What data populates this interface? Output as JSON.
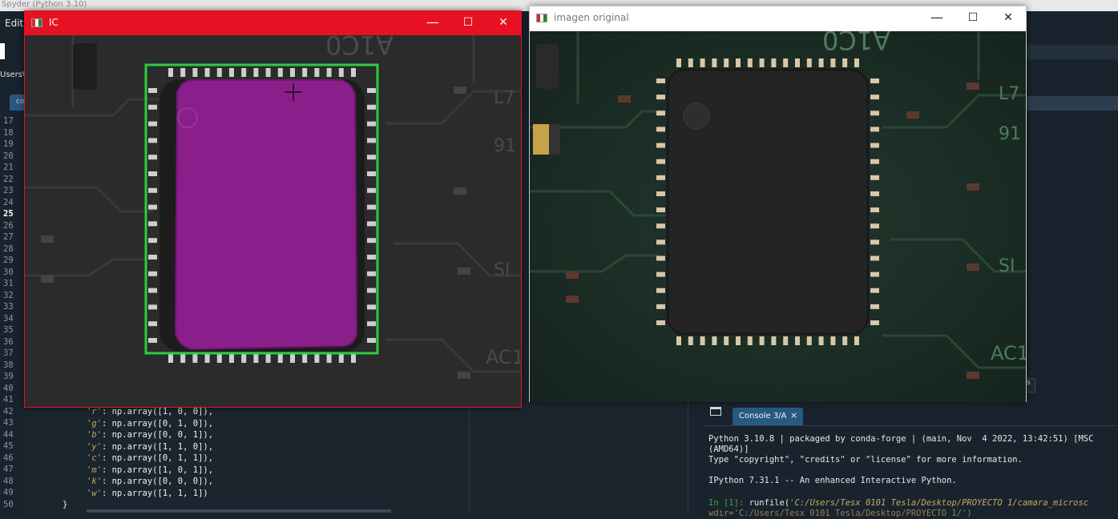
{
  "spyder": {
    "title": "Spyder (Python 3.10)",
    "menu_edit": "Edit",
    "path_fragment": "Users\\",
    "editor_tab": "co",
    "line_numbers": [
      "17",
      "18",
      "19",
      "20",
      "21",
      "22",
      "23",
      "24",
      "25",
      "26",
      "27",
      "28",
      "29",
      "30",
      "31",
      "32",
      "33",
      "34",
      "35",
      "36",
      "37",
      "38",
      "39",
      "40",
      "41",
      "42",
      "43",
      "44",
      "45",
      "46",
      "47",
      "48",
      "49",
      "50"
    ],
    "current_line": "25",
    "code_lines": [
      {
        "key": "'r'",
        "rest": ": np.array([1, 0, 0]),"
      },
      {
        "key": "'g'",
        "rest": ": np.array([0, 1, 0]),"
      },
      {
        "key": "'b'",
        "rest": ": np.array([0, 0, 1]),"
      },
      {
        "key": "'y'",
        "rest": ": np.array([1, 1, 0]),"
      },
      {
        "key": "'c'",
        "rest": ": np.array([0, 1, 1]),"
      },
      {
        "key": "'m'",
        "rest": ": np.array([1, 0, 1]),"
      },
      {
        "key": "'k'",
        "rest": ": np.array([0, 0, 0]),"
      },
      {
        "key": "'w'",
        "rest": ": np.array([1, 1, 1])"
      }
    ],
    "closing_brace": "}",
    "right_pane_fragment": "s",
    "console": {
      "tab_label": "Console 3/A",
      "tab_close": "×",
      "lines": [
        "Python 3.10.8 | packaged by conda-forge | (main, Nov  4 2022, 13:42:51) [MSC",
        "(AMD64)]",
        "Type \"copyright\", \"credits\" or \"license\" for more information.",
        "",
        "IPython 7.31.1 -- An enhanced Interactive Python."
      ],
      "prompt": "In [1]: ",
      "prompt_cmd": "runfile(",
      "prompt_arg": "'C:/Users/Tesx 0101 Tesla/Desktop/PROYECTO 1/camara_microsc",
      "next_line": "wdir='C:/Users/Tesx 0101 Tesla/Desktop/PROYECTO 1/')"
    }
  },
  "windows": {
    "ic": {
      "title": "IC",
      "titlebar_color": "#e81123",
      "minimize": "—",
      "maximize": "☐",
      "close": "✕",
      "fill_color": "#8a1f8c",
      "box_color": "#2ecc40"
    },
    "original": {
      "title": "imagen original",
      "minimize": "—",
      "maximize": "☐",
      "close": "✕"
    }
  }
}
